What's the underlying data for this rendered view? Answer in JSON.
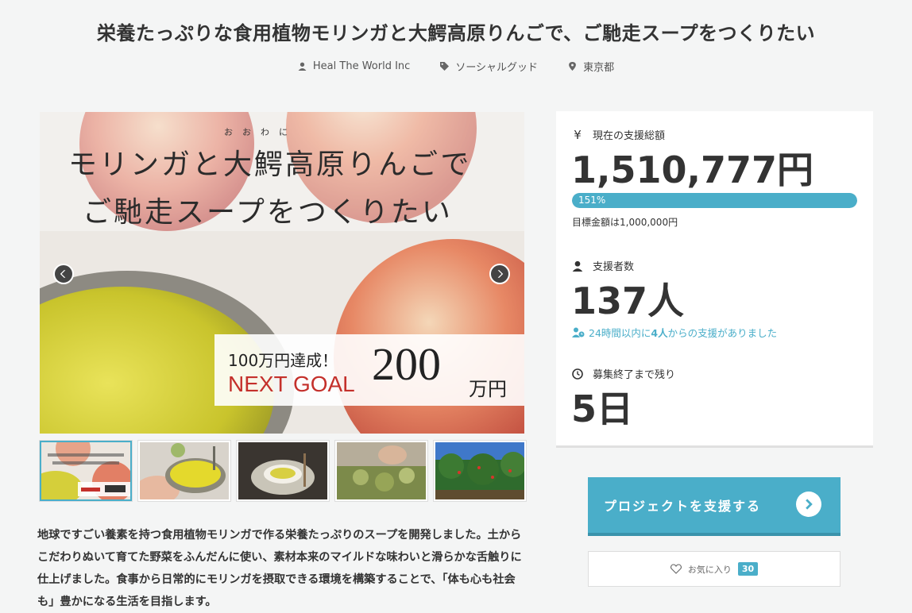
{
  "project": {
    "title": "栄養たっぷりな食用植物モリンガと大鰐高原りんごで、ご馳走スープをつくりたい",
    "owner": "Heal The World Inc",
    "category": "ソーシャルグッド",
    "location": "東京都"
  },
  "hero": {
    "ruby": "おおわに",
    "line1": "モリンガと大鰐高原りんごで",
    "line2": "ご馳走スープをつくりたい",
    "achieved": "100万円達成！",
    "next_goal": "NEXT GOAL",
    "goal_amount": "200",
    "goal_unit": "万円"
  },
  "thumbnails": [
    {
      "name": "thumb-1",
      "active": true
    },
    {
      "name": "thumb-2",
      "active": false
    },
    {
      "name": "thumb-3",
      "active": false
    },
    {
      "name": "thumb-4",
      "active": false
    },
    {
      "name": "thumb-5",
      "active": false
    }
  ],
  "description": "地球ですごい養素を持つ食用植物モリンガで作る栄養たっぷりのスープを開発しました。土からこだわりぬいて育てた野菜をふんだんに使い、素材本来のマイルドな味わいと滑らかな舌触りに仕上げました。食事から日常的にモリンガを摂取できる環境を構築することで、「体も心も社会も」豊かになる生活を目指します。",
  "stats": {
    "total_label": "現在の支援総額",
    "total_icon": "¥",
    "total_value": "1,510,777円",
    "progress_percent": 151,
    "progress_label": "151%",
    "goal_text": "目標金額は1,000,000円",
    "backers_label": "支援者数",
    "backers_value": "137人",
    "recent_prefix": "24時間以内に",
    "recent_count": "4人",
    "recent_suffix": "からの支援がありました",
    "remaining_label": "募集終了まで残り",
    "remaining_value": "5日"
  },
  "actions": {
    "support_label": "プロジェクトを支援する",
    "favorite_label": "お気に入り",
    "favorite_count": "30"
  },
  "colors": {
    "accent": "#4aaec9",
    "next_goal_red": "#c4302b"
  }
}
